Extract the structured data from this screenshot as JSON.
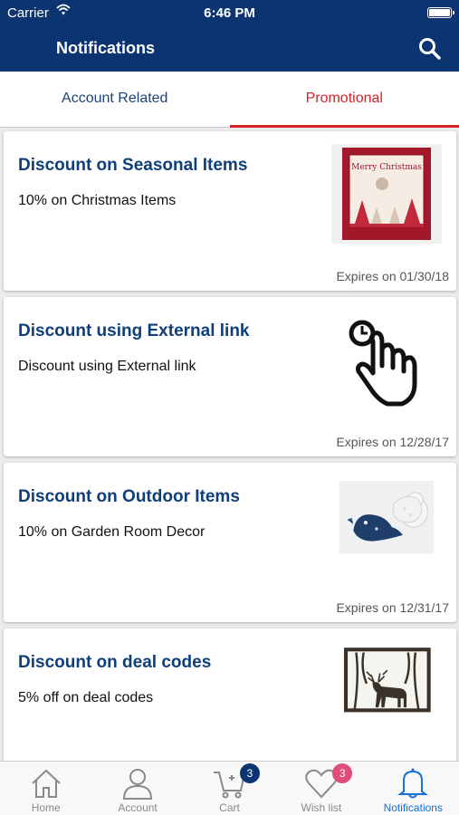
{
  "status_bar": {
    "carrier": "Carrier",
    "time": "6:46 PM"
  },
  "header": {
    "title": "Notifications",
    "search_icon": "search-icon"
  },
  "tabs": [
    {
      "label": "Account Related",
      "active": false
    },
    {
      "label": "Promotional",
      "active": true
    }
  ],
  "colors": {
    "header": "#0c3470",
    "active_tab": "#d3222a",
    "title_text": "#0f3f7a",
    "tabbar_active": "#1a6fd6"
  },
  "notifications": [
    {
      "title": "Discount on Seasonal Items",
      "subtitle": "10% on Christmas Items",
      "expiry": "Expires on 01/30/18",
      "image": "christmas-card-image",
      "image_text": "Merry Christmas"
    },
    {
      "title": "Discount using External link",
      "subtitle": "Discount using External link",
      "expiry": "Expires on 12/28/17",
      "image": "pointing-hand-icon"
    },
    {
      "title": "Discount on Outdoor Items",
      "subtitle": "10% on Garden Room Decor",
      "expiry": "Expires on 12/31/17",
      "image": "ceramic-birds-image"
    },
    {
      "title": "Discount on deal codes",
      "subtitle": "5% off on deal codes",
      "expiry": "",
      "image": "deer-forest-art-image"
    }
  ],
  "tab_bar": [
    {
      "label": "Home",
      "icon": "home-icon"
    },
    {
      "label": "Account",
      "icon": "account-icon"
    },
    {
      "label": "Cart",
      "icon": "cart-icon",
      "badge": "3"
    },
    {
      "label": "Wish list",
      "icon": "heart-icon",
      "badge": "3"
    },
    {
      "label": "Notifications",
      "icon": "bell-icon",
      "active": true
    }
  ]
}
